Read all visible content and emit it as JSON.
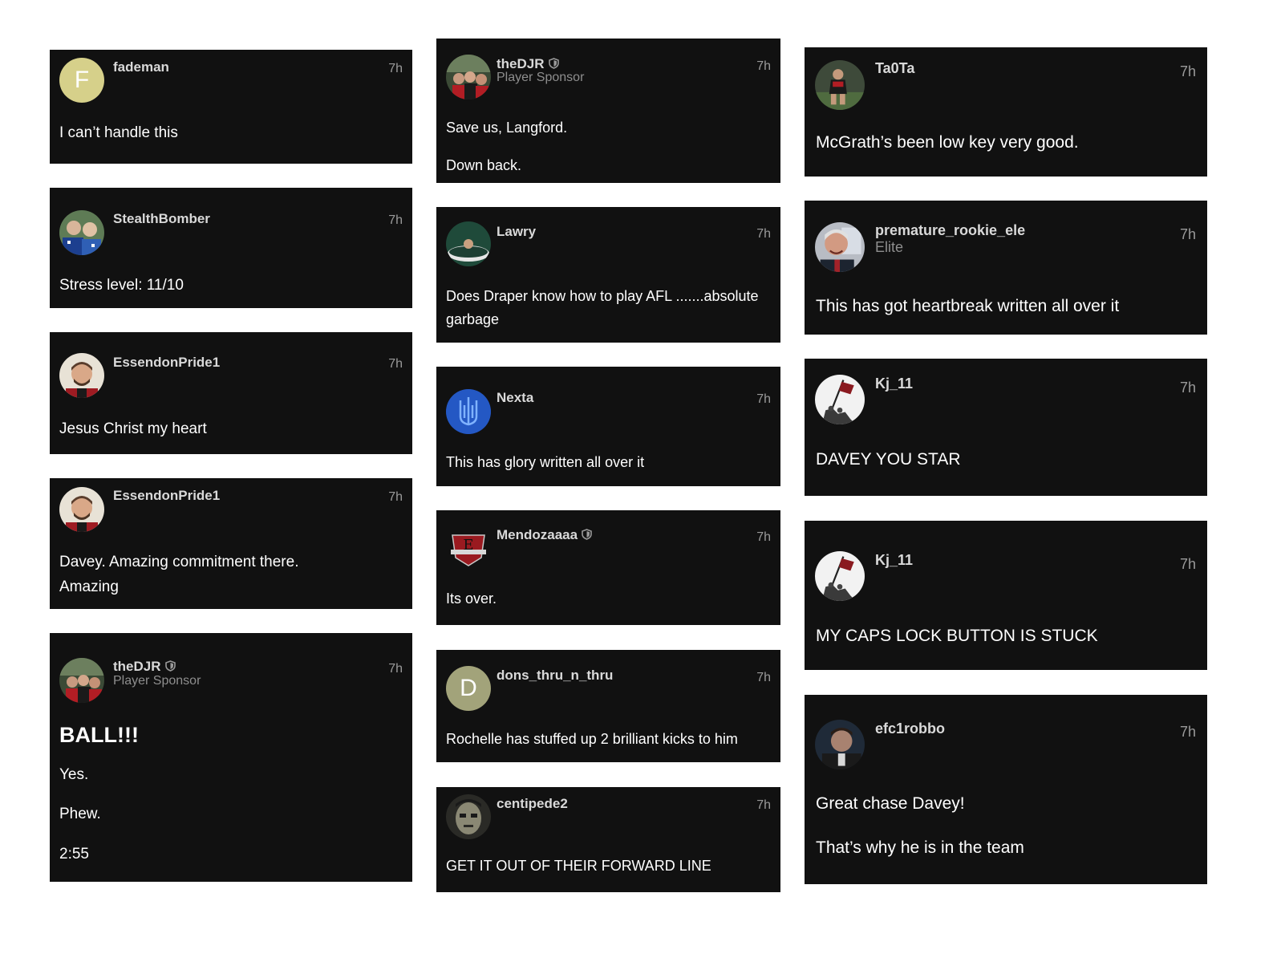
{
  "comments": [
    {
      "username": "fademan",
      "time": "7h",
      "avatar": "letter-F-avatar",
      "avatar_letter": "F",
      "lines": [
        "I can’t handle this"
      ]
    },
    {
      "username": "StealthBomber",
      "time": "7h",
      "avatar": "photo-avatar",
      "lines": [
        "Stress level: 11/10"
      ]
    },
    {
      "username": "EssendonPride1",
      "time": "7h",
      "avatar": "photo-avatar",
      "lines": [
        "Jesus Christ my heart"
      ]
    },
    {
      "username": "EssendonPride1",
      "time": "7h",
      "avatar": "photo-avatar",
      "lines": [
        "Davey. Amazing commitment there.",
        "Amazing"
      ]
    },
    {
      "username": "theDJR",
      "time": "7h",
      "subtitle": "Player Sponsor",
      "avatar": "photo-avatar",
      "badge": "shield-icon",
      "lines": [
        "BALL!!!",
        "Yes.",
        "Phew.",
        "2:55"
      ]
    },
    {
      "username": "theDJR",
      "time": "7h",
      "subtitle": "Player Sponsor",
      "avatar": "photo-avatar",
      "badge": "shield-icon",
      "lines": [
        "Save us, Langford.",
        "Down back."
      ]
    },
    {
      "username": "Lawry",
      "time": "7h",
      "avatar": "photo-avatar",
      "lines": [
        "Does Draper know how to play AFL .......absolute",
        "garbage"
      ]
    },
    {
      "username": "Nexta",
      "time": "7h",
      "avatar": "trident-avatar",
      "lines": [
        "This has glory written all over it"
      ]
    },
    {
      "username": "Mendozaaaa",
      "time": "7h",
      "avatar": "club-logo-avatar",
      "badge": "shield-icon",
      "lines": [
        "Its over."
      ]
    },
    {
      "username": "dons_thru_n_thru",
      "time": "7h",
      "avatar": "letter-D-avatar",
      "avatar_letter": "D",
      "lines": [
        "Rochelle has stuffed up 2 brilliant kicks to him"
      ]
    },
    {
      "username": "centipede2",
      "time": "7h",
      "avatar": "photo-avatar",
      "lines": [
        "GET IT OUT OF THEIR FORWARD LINE"
      ]
    },
    {
      "username": "Ta0Ta",
      "time": "7h",
      "avatar": "photo-avatar",
      "lines": [
        "McGrath’s been low key very good."
      ]
    },
    {
      "username": "premature_rookie_ele",
      "time": "7h",
      "subtitle": "Elite",
      "avatar": "photo-avatar",
      "lines": [
        "This has got heartbreak written all over it"
      ]
    },
    {
      "username": "Kj_11",
      "time": "7h",
      "avatar": "flag-raising-avatar",
      "lines": [
        "DAVEY YOU STAR"
      ]
    },
    {
      "username": "Kj_11",
      "time": "7h",
      "avatar": "flag-raising-avatar",
      "lines": [
        "MY CAPS LOCK BUTTON IS STUCK"
      ]
    },
    {
      "username": "efc1robbo",
      "time": "7h",
      "avatar": "photo-avatar",
      "lines": [
        "Great chase Davey!",
        "That’s why he is in the team"
      ]
    }
  ],
  "colors": {
    "card_bg": "#111111",
    "page_bg": "#ffffff",
    "username": "#d9d9d9",
    "subtitle": "#8e8e8e",
    "time": "#9a9a9a",
    "text": "#ffffff"
  }
}
